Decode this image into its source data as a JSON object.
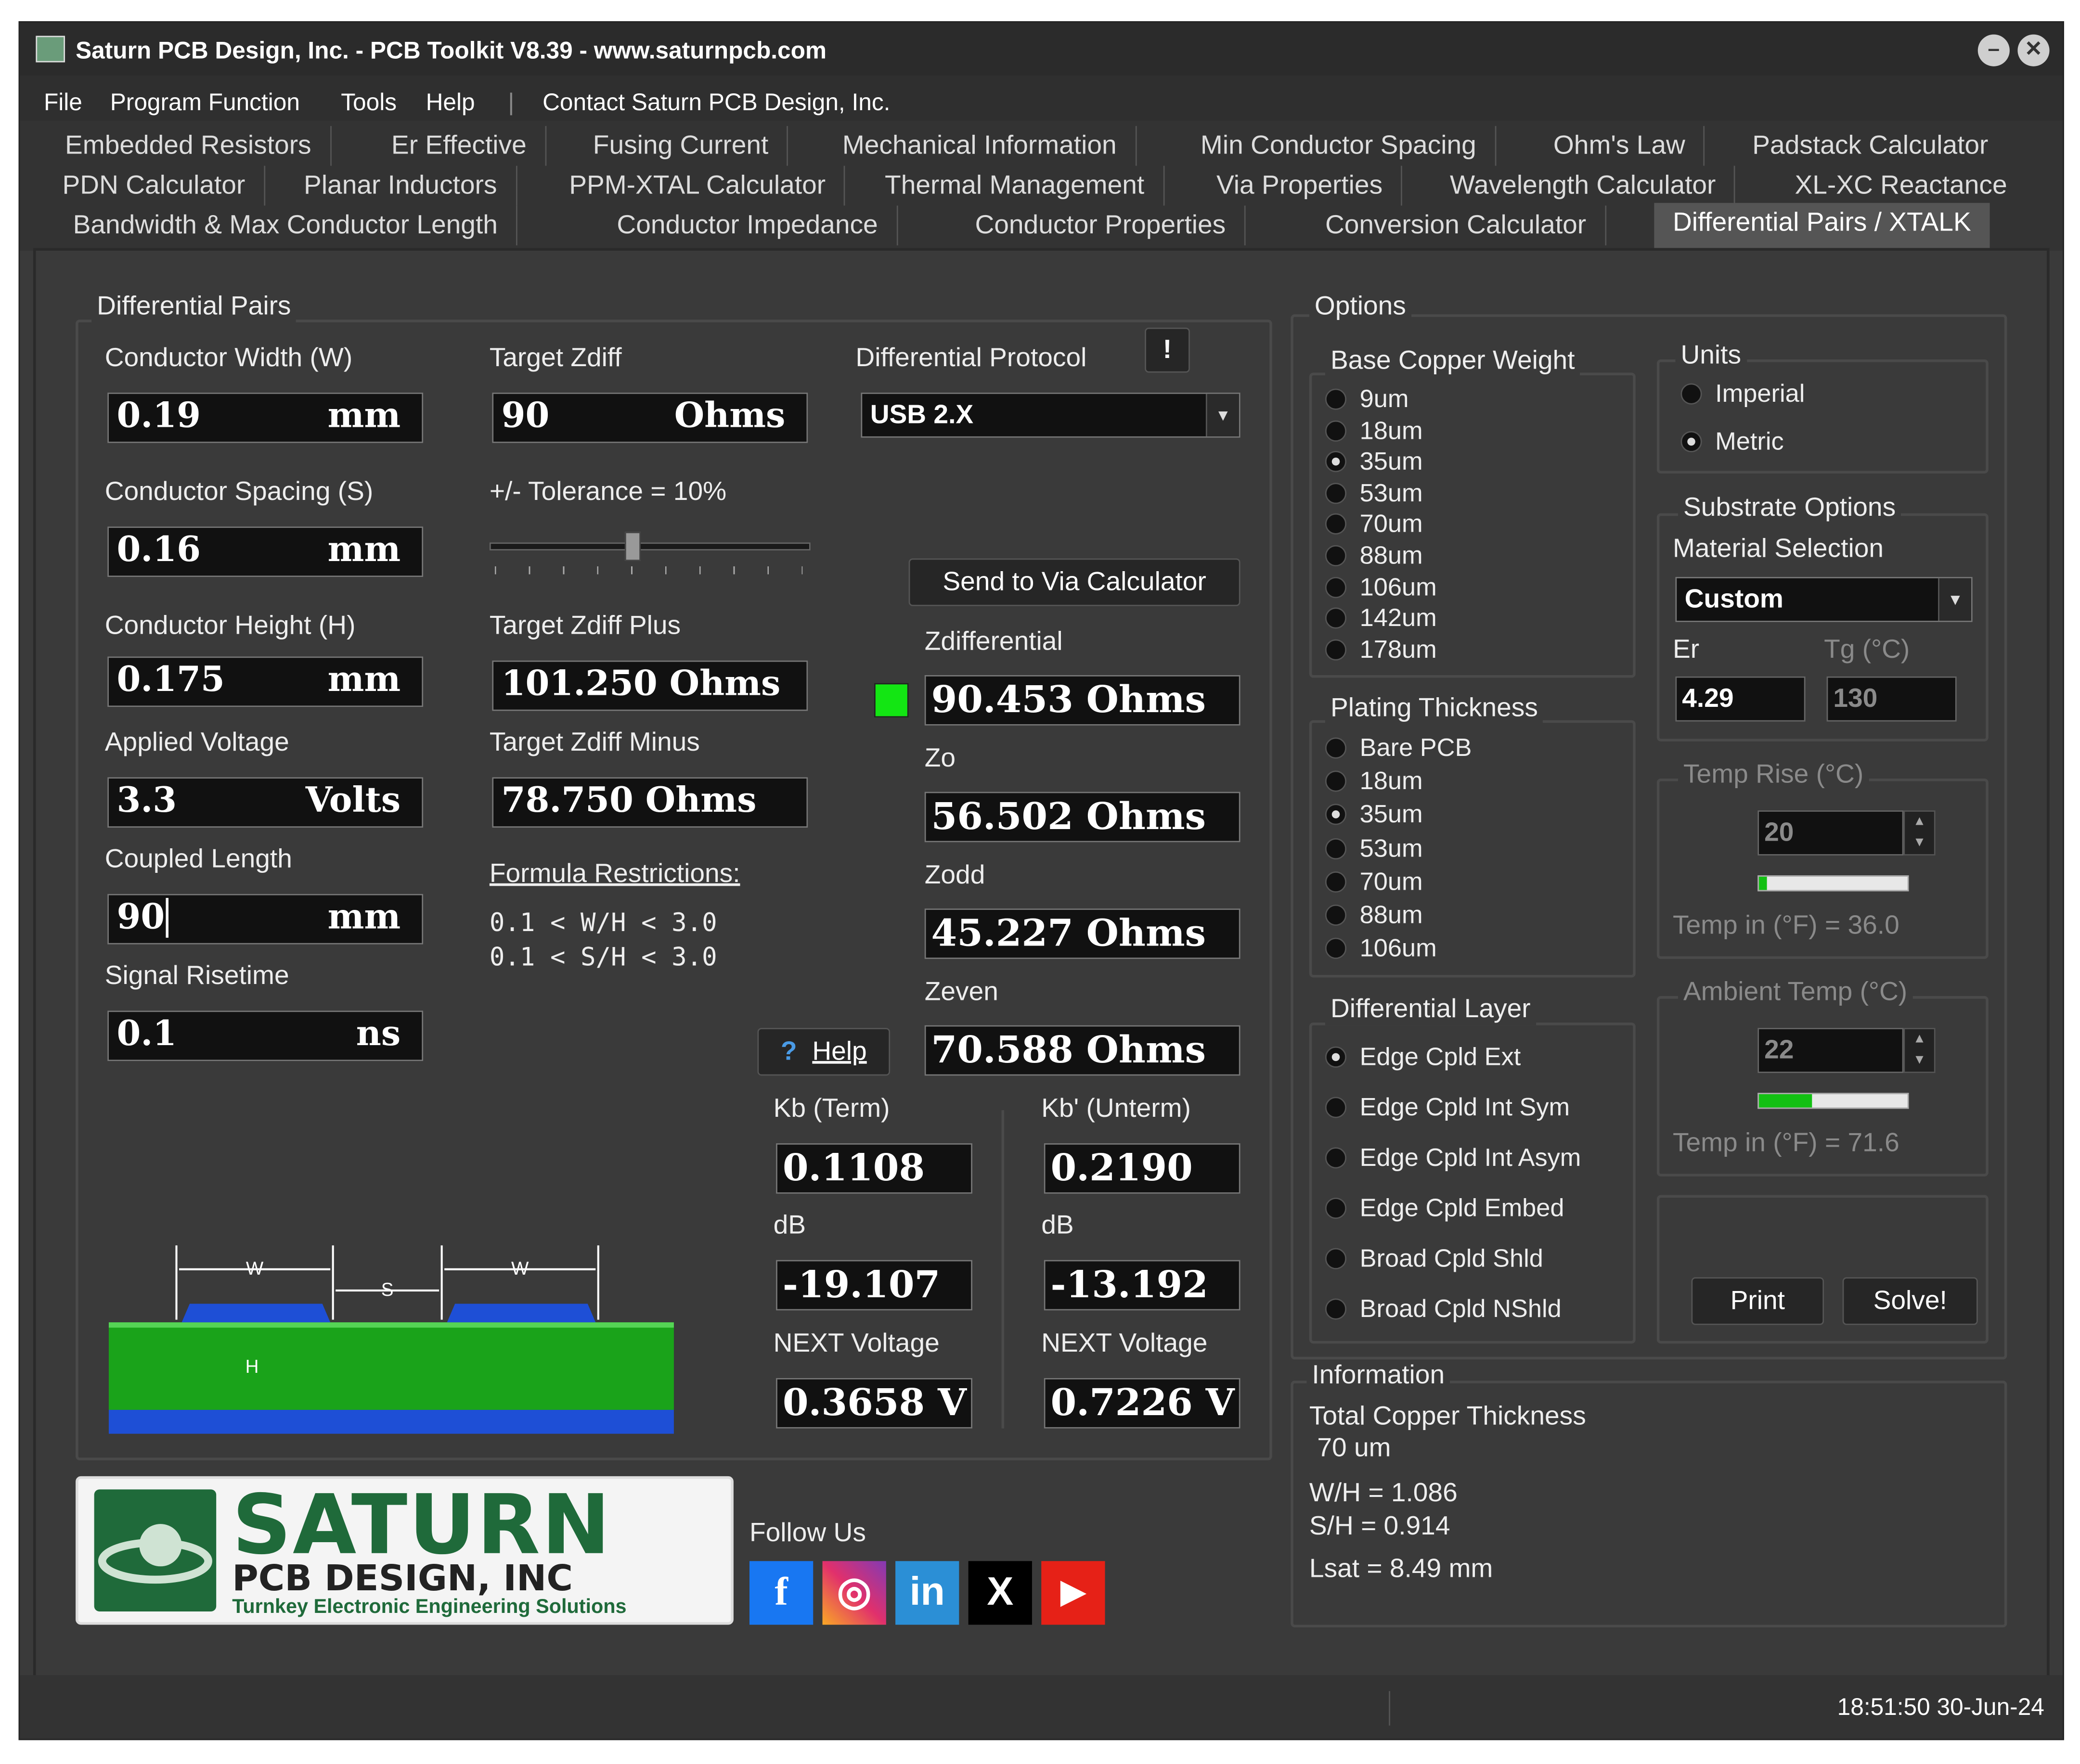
{
  "window": {
    "title": "Saturn PCB Design, Inc. - PCB Toolkit V8.39 - www.saturnpcb.com",
    "minimize": "–",
    "close": "✕"
  },
  "menu": {
    "file": "File",
    "program_function": "Program Function",
    "tools": "Tools",
    "help": "Help",
    "sep": "|",
    "contact": "Contact Saturn PCB Design, Inc."
  },
  "tabs": {
    "row1": [
      "Embedded Resistors",
      "Er Effective",
      "Fusing Current",
      "Mechanical Information",
      "Min Conductor Spacing",
      "Ohm's Law",
      "Padstack Calculator"
    ],
    "row2": [
      "PDN Calculator",
      "Planar Inductors",
      "PPM-XTAL Calculator",
      "Thermal Management",
      "Via Properties",
      "Wavelength Calculator",
      "XL-XC Reactance"
    ],
    "row3": [
      "Bandwidth & Max Conductor Length",
      "Conductor Impedance",
      "Conductor Properties",
      "Conversion Calculator",
      "Differential Pairs / XTALK"
    ]
  },
  "diff": {
    "group_title": "Differential Pairs",
    "width_label": "Conductor Width (W)",
    "width_value": "0.19",
    "width_unit": "mm",
    "spacing_label": "Conductor Spacing (S)",
    "spacing_value": "0.16",
    "spacing_unit": "mm",
    "height_label": "Conductor Height (H)",
    "height_value": "0.175",
    "height_unit": "mm",
    "voltage_label": "Applied Voltage",
    "voltage_value": "3.3",
    "voltage_unit": "Volts",
    "length_label": "Coupled Length",
    "length_value": "90",
    "length_unit": "mm",
    "risetime_label": "Signal Risetime",
    "risetime_value": "0.1",
    "risetime_unit": "ns",
    "target_label": "Target Zdiff",
    "target_value": "90",
    "target_unit": "Ohms",
    "tolerance_label": "+/- Tolerance = 10%",
    "tolerance_slider": 0.45,
    "plus_label": "Target Zdiff Plus",
    "plus_value": "101.250 Ohms",
    "minus_label": "Target Zdiff Minus",
    "minus_value": "78.750 Ohms",
    "formula_title": "Formula Restrictions:",
    "formula_line1": "0.1 < W/H < 3.0",
    "formula_line2": "0.1 < S/H < 3.0",
    "protocol_label": "Differential Protocol",
    "protocol_alert": "!",
    "protocol_value": "USB 2.X",
    "send_button": "Send to Via Calculator",
    "zdiff_label": "Zdifferential",
    "zdiff_value": "90.453 Ohms",
    "zdiff_indicator": "#13e613",
    "zo_label": "Zo",
    "zo_value": "56.502 Ohms",
    "zodd_label": "Zodd",
    "zodd_value": "45.227 Ohms",
    "zeven_label": "Zeven",
    "zeven_value": "70.588 Ohms",
    "help_icon": "?",
    "help_button": "Help",
    "kb_label": "Kb (Term)",
    "kb_value": "0.1108",
    "kbp_label": "Kb' (Unterm)",
    "kbp_value": "0.2190",
    "db_label": "dB",
    "db_value": "-19.107",
    "dbp_label": "dB",
    "dbp_value": "-13.192",
    "next_label": "NEXT Voltage",
    "next_value": "0.3658 V",
    "nextp_label": "NEXT Voltage",
    "nextp_value": "0.7226 V",
    "diagram": {
      "w": "W",
      "s": "S",
      "h": "H"
    }
  },
  "options": {
    "group_title": "Options",
    "copper_title": "Base Copper Weight",
    "copper": [
      "9um",
      "18um",
      "35um",
      "53um",
      "70um",
      "88um",
      "106um",
      "142um",
      "178um"
    ],
    "copper_selected": 2,
    "plating_title": "Plating Thickness",
    "plating": [
      "Bare PCB",
      "18um",
      "35um",
      "53um",
      "70um",
      "88um",
      "106um"
    ],
    "plating_selected": 2,
    "layer_title": "Differential Layer",
    "layers": [
      "Edge Cpld Ext",
      "Edge Cpld Int Sym",
      "Edge Cpld Int Asym",
      "Edge Cpld Embed",
      "Broad Cpld Shld",
      "Broad Cpld NShld"
    ],
    "layer_selected": 0,
    "units_title": "Units",
    "units_imperial": "Imperial",
    "units_metric": "Metric",
    "substrate_title": "Substrate Options",
    "material_label": "Material Selection",
    "material_value": "Custom",
    "er_label": "Er",
    "er_value": "4.29",
    "tg_label": "Tg (°C)",
    "tg_value": "130",
    "temprise_title": "Temp Rise (°C)",
    "temprise_value": "20",
    "temprise_f": "Temp in (°F) = 36.0",
    "temprise_bar": 0.05,
    "ambient_title": "Ambient Temp (°C)",
    "ambient_value": "22",
    "ambient_f": "Temp in (°F) = 71.6",
    "ambient_bar": 0.36,
    "print_button": "Print",
    "solve_button": "Solve!"
  },
  "info": {
    "title": "Information",
    "copper_label": "Total Copper Thickness",
    "copper_value": "70 um",
    "wh": "W/H =  1.086",
    "sh": "S/H =  0.914",
    "lsat": "Lsat = 8.49 mm"
  },
  "brand": {
    "logo_main": "SATURN",
    "logo_sub": "PCB DESIGN, INC",
    "logo_tag": "Turnkey Electronic Engineering Solutions",
    "follow": "Follow Us"
  },
  "social": {
    "facebook": "f",
    "instagram": "◎",
    "linkedin": "in",
    "x": "X",
    "youtube": "▶"
  },
  "status": {
    "time": "18:51:50  30-Jun-24"
  },
  "colors": {
    "green": "#13e613",
    "board_green": "#1aa31a",
    "copper_blue": "#1e4fd6"
  }
}
